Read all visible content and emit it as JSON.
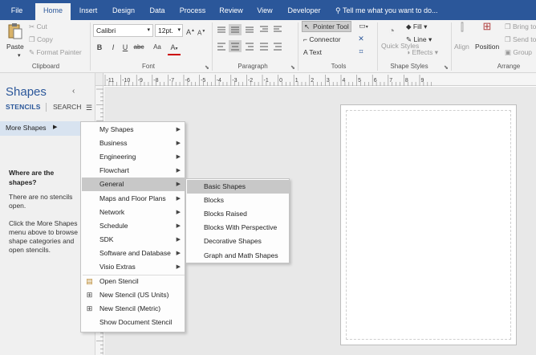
{
  "tabs": [
    "File",
    "Home",
    "Insert",
    "Design",
    "Data",
    "Process",
    "Review",
    "View",
    "Developer"
  ],
  "active_tab": "Home",
  "tell_me": "Tell me what you want to do...",
  "ribbon": {
    "clipboard": {
      "paste": "Paste",
      "cut": "Cut",
      "copy": "Copy",
      "format_painter": "Format Painter",
      "label": "Clipboard"
    },
    "font": {
      "font_name": "Calibri",
      "font_size": "12pt.",
      "grow": "A",
      "shrink": "A",
      "bold": "B",
      "italic": "I",
      "underline": "U",
      "strike": "abc",
      "case": "Aa",
      "font_color": "A",
      "label": "Font"
    },
    "paragraph": {
      "label": "Paragraph"
    },
    "tools": {
      "pointer_tool": "Pointer Tool",
      "connector": "Connector",
      "text": "Text",
      "label": "Tools"
    },
    "shape_styles": {
      "quick_styles": "Quick Styles",
      "fill": "Fill",
      "line": "Line",
      "effects": "Effects",
      "label": "Shape Styles"
    },
    "arrange": {
      "align": "Align",
      "position": "Position",
      "bring_to_front": "Bring to",
      "send_to_back": "Send to",
      "group": "Group",
      "label": "Arrange"
    }
  },
  "pane": {
    "title": "Shapes",
    "tab_stencils": "STENCILS",
    "tab_search": "SEARCH",
    "more_shapes": "More Shapes",
    "heading": "Where are the shapes?",
    "text1": "There are no stencils open.",
    "text2": "Click the More Shapes menu above to browse shape categories and open stencils."
  },
  "ruler_labels": [
    "-11",
    "-10",
    "-9",
    "-8",
    "-7",
    "-6",
    "-5",
    "-4",
    "-3",
    "-2",
    "-1",
    "0",
    "1",
    "2",
    "3",
    "4",
    "5",
    "6",
    "7",
    "8",
    "9"
  ],
  "menu_main": [
    {
      "label": "My Shapes",
      "submenu": true
    },
    {
      "label": "Business",
      "submenu": true
    },
    {
      "label": "Engineering",
      "submenu": true
    },
    {
      "label": "Flowchart",
      "submenu": true
    },
    {
      "label": "General",
      "submenu": true,
      "highlighted": true
    },
    {
      "label": "Maps and Floor Plans",
      "submenu": true
    },
    {
      "label": "Network",
      "submenu": true
    },
    {
      "label": "Schedule",
      "submenu": true
    },
    {
      "label": "SDK",
      "submenu": true
    },
    {
      "label": "Software and Database",
      "submenu": true
    },
    {
      "label": "Visio Extras",
      "submenu": true
    },
    {
      "label": "Open Stencil",
      "icon": "open-stencil-icon"
    },
    {
      "label": "New Stencil (US Units)",
      "icon": "new-stencil-icon"
    },
    {
      "label": "New Stencil (Metric)",
      "icon": "new-stencil-icon"
    },
    {
      "label": "Show Document Stencil"
    }
  ],
  "menu_general": [
    {
      "label": "Basic Shapes",
      "highlighted": true
    },
    {
      "label": "Blocks"
    },
    {
      "label": "Blocks Raised"
    },
    {
      "label": "Blocks With Perspective"
    },
    {
      "label": "Decorative Shapes"
    },
    {
      "label": "Graph and Math Shapes"
    }
  ],
  "colors": {
    "accent": "#2b579a",
    "menu_highlight": "#c8c8c8",
    "canvas": "#e8e8e8"
  }
}
